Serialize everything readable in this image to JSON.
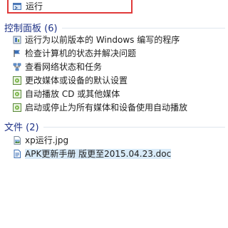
{
  "top_result": {
    "label": "运行",
    "icon": "run-icon"
  },
  "control_panel": {
    "header": "控制面板 (6)",
    "items": [
      {
        "label": "运行为以前版本的 Windows 编写的程序",
        "icon": "compatibility-icon"
      },
      {
        "label": "检查计算机的状态并解决问题",
        "icon": "action-center-flag-icon"
      },
      {
        "label": "查看网络状态和任务",
        "icon": "network-icon"
      },
      {
        "label": "更改媒体或设备的默认设置",
        "icon": "autoplay-icon"
      },
      {
        "label": "自动播放 CD 或其他媒体",
        "icon": "autoplay-icon"
      },
      {
        "label": "启动或停止为所有媒体和设备使用自动播放",
        "icon": "autoplay-icon"
      }
    ]
  },
  "files": {
    "header": "文件 (2)",
    "items": [
      {
        "label": "xp运行.jpg",
        "icon": "image-file-icon"
      },
      {
        "label": "APK更新手册 版更至2015.04.23.doc",
        "icon": "document-file-icon"
      }
    ]
  },
  "colors": {
    "highlight_border": "#e03a3a",
    "header_text": "#1e3287",
    "selection": "#d9ebf9"
  }
}
